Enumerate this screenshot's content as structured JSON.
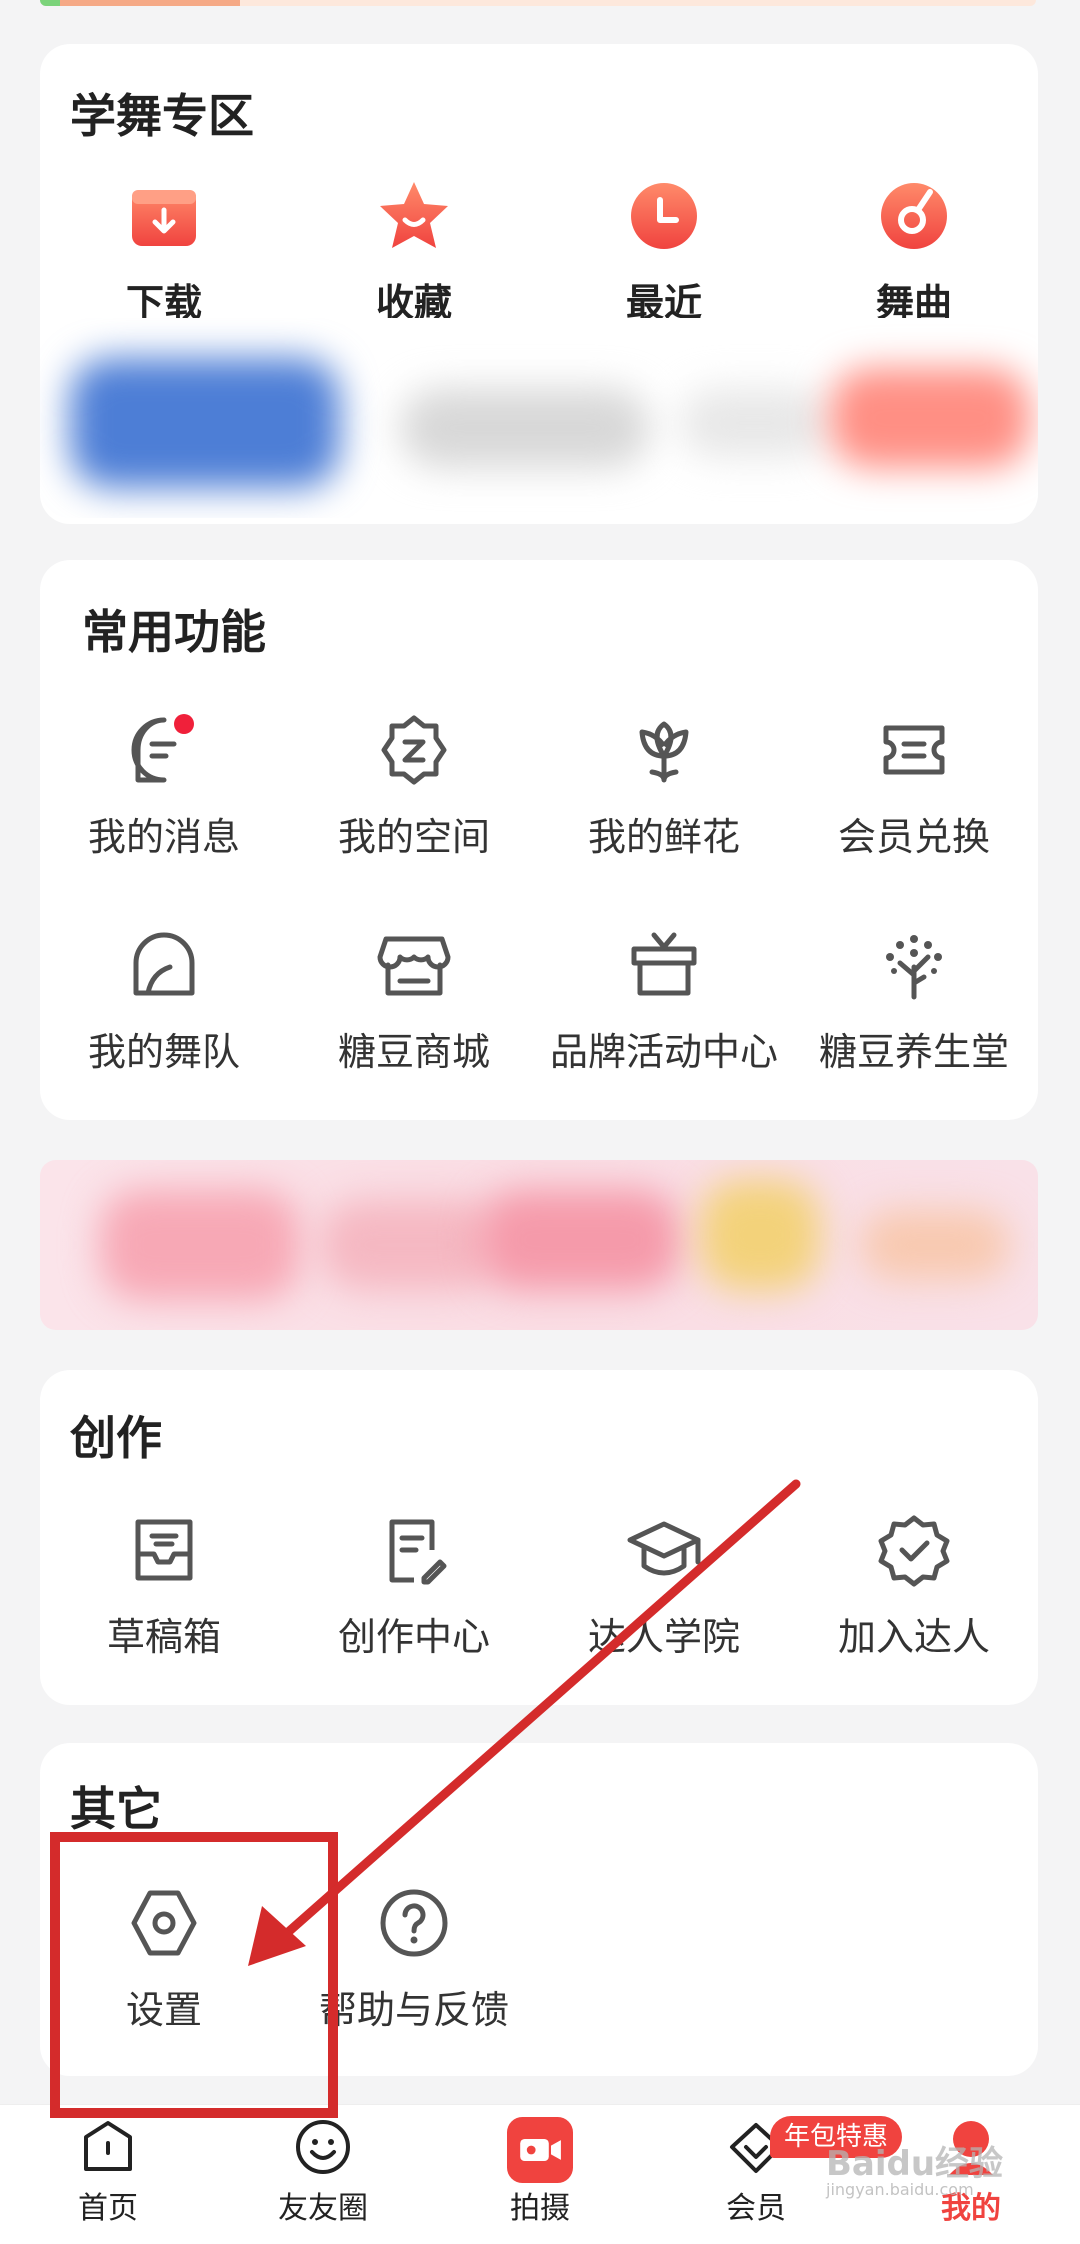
{
  "dance_zone": {
    "title": "学舞专区",
    "items": [
      {
        "label": "下载",
        "icon": "download-icon"
      },
      {
        "label": "收藏",
        "icon": "star-icon"
      },
      {
        "label": "最近",
        "icon": "clock-icon"
      },
      {
        "label": "舞曲",
        "icon": "music-disc-icon"
      }
    ]
  },
  "common": {
    "title": "常用功能",
    "items": [
      {
        "label": "我的消息",
        "icon": "message-icon"
      },
      {
        "label": "我的空间",
        "icon": "space-icon"
      },
      {
        "label": "我的鲜花",
        "icon": "flower-icon"
      },
      {
        "label": "会员兑换",
        "icon": "ticket-icon"
      },
      {
        "label": "我的舞队",
        "icon": "team-icon"
      },
      {
        "label": "糖豆商城",
        "icon": "store-icon"
      },
      {
        "label": "品牌活动中心",
        "icon": "gift-icon"
      },
      {
        "label": "糖豆养生堂",
        "icon": "tree-icon"
      }
    ]
  },
  "create": {
    "title": "创作",
    "items": [
      {
        "label": "草稿箱",
        "icon": "draft-box-icon"
      },
      {
        "label": "创作中心",
        "icon": "edit-doc-icon"
      },
      {
        "label": "达人学院",
        "icon": "graduation-cap-icon"
      },
      {
        "label": "加入达人",
        "icon": "verified-badge-icon"
      }
    ]
  },
  "other": {
    "title": "其它",
    "items": [
      {
        "label": "设置",
        "icon": "settings-icon"
      },
      {
        "label": "帮助与反馈",
        "icon": "help-icon"
      }
    ]
  },
  "tabbar": {
    "items": [
      {
        "label": "首页",
        "icon": "home-icon"
      },
      {
        "label": "友友圈",
        "icon": "smile-icon"
      },
      {
        "label": "拍摄",
        "icon": "camera-icon"
      },
      {
        "label": "会员",
        "icon": "vip-diamond-icon"
      },
      {
        "label": "我的",
        "icon": "profile-icon"
      }
    ],
    "promo_badge": "年包特惠"
  },
  "watermark": {
    "text": "Baidu经验",
    "sub": "jingyan.baidu.com"
  },
  "colors": {
    "accent": "#f0433f",
    "annotation": "#d42b2b",
    "icon_gray": "#555555"
  }
}
